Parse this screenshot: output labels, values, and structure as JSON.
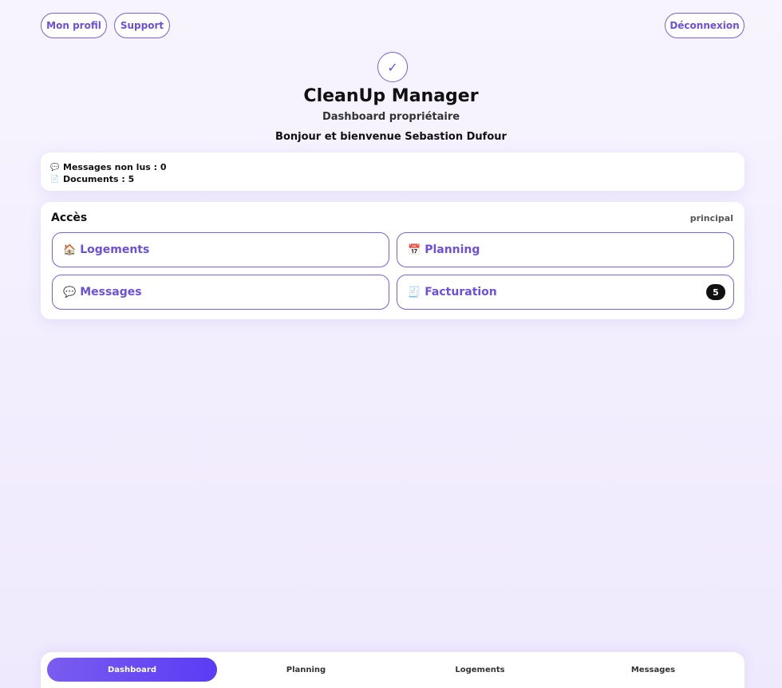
{
  "header": {
    "profile_label": "Mon profil",
    "support_label": "Support",
    "logout_label": "Déconnexion"
  },
  "brand": {
    "logo_glyph": "✓",
    "title": "CleanUp Manager",
    "subtitle": "Dashboard propriétaire",
    "welcome": "Bonjour et bienvenue Sebastion Dufour"
  },
  "stats": {
    "items": [
      {
        "icon": "speech-bubble-icon",
        "glyph": "💬",
        "text": "Messages non lus : 0"
      },
      {
        "icon": "document-icon",
        "glyph": "📄",
        "text": "Documents : 5"
      }
    ]
  },
  "access": {
    "title": "Accès",
    "badge": "principal",
    "tiles": [
      {
        "icon": "house-icon",
        "glyph": "🏠",
        "label": "Logements"
      },
      {
        "icon": "calendar-icon",
        "glyph": "📅",
        "label": "Planning"
      },
      {
        "icon": "speech-bubble-icon",
        "glyph": "💬",
        "label": "Messages"
      },
      {
        "icon": "receipt-icon",
        "glyph": "🧾",
        "label": "Facturation",
        "count": "5"
      }
    ]
  },
  "bottom_nav": {
    "items": [
      {
        "label": "Dashboard",
        "active": true
      },
      {
        "label": "Planning",
        "active": false
      },
      {
        "label": "Logements",
        "active": false
      },
      {
        "label": "Messages",
        "active": false
      }
    ]
  },
  "colors": {
    "accent": "#6c4fe0",
    "accent_border": "#7c5ce6",
    "active_gradient_start": "#7a5cf0",
    "active_gradient_end": "#5b3cf5",
    "badge_bg": "#111111"
  }
}
